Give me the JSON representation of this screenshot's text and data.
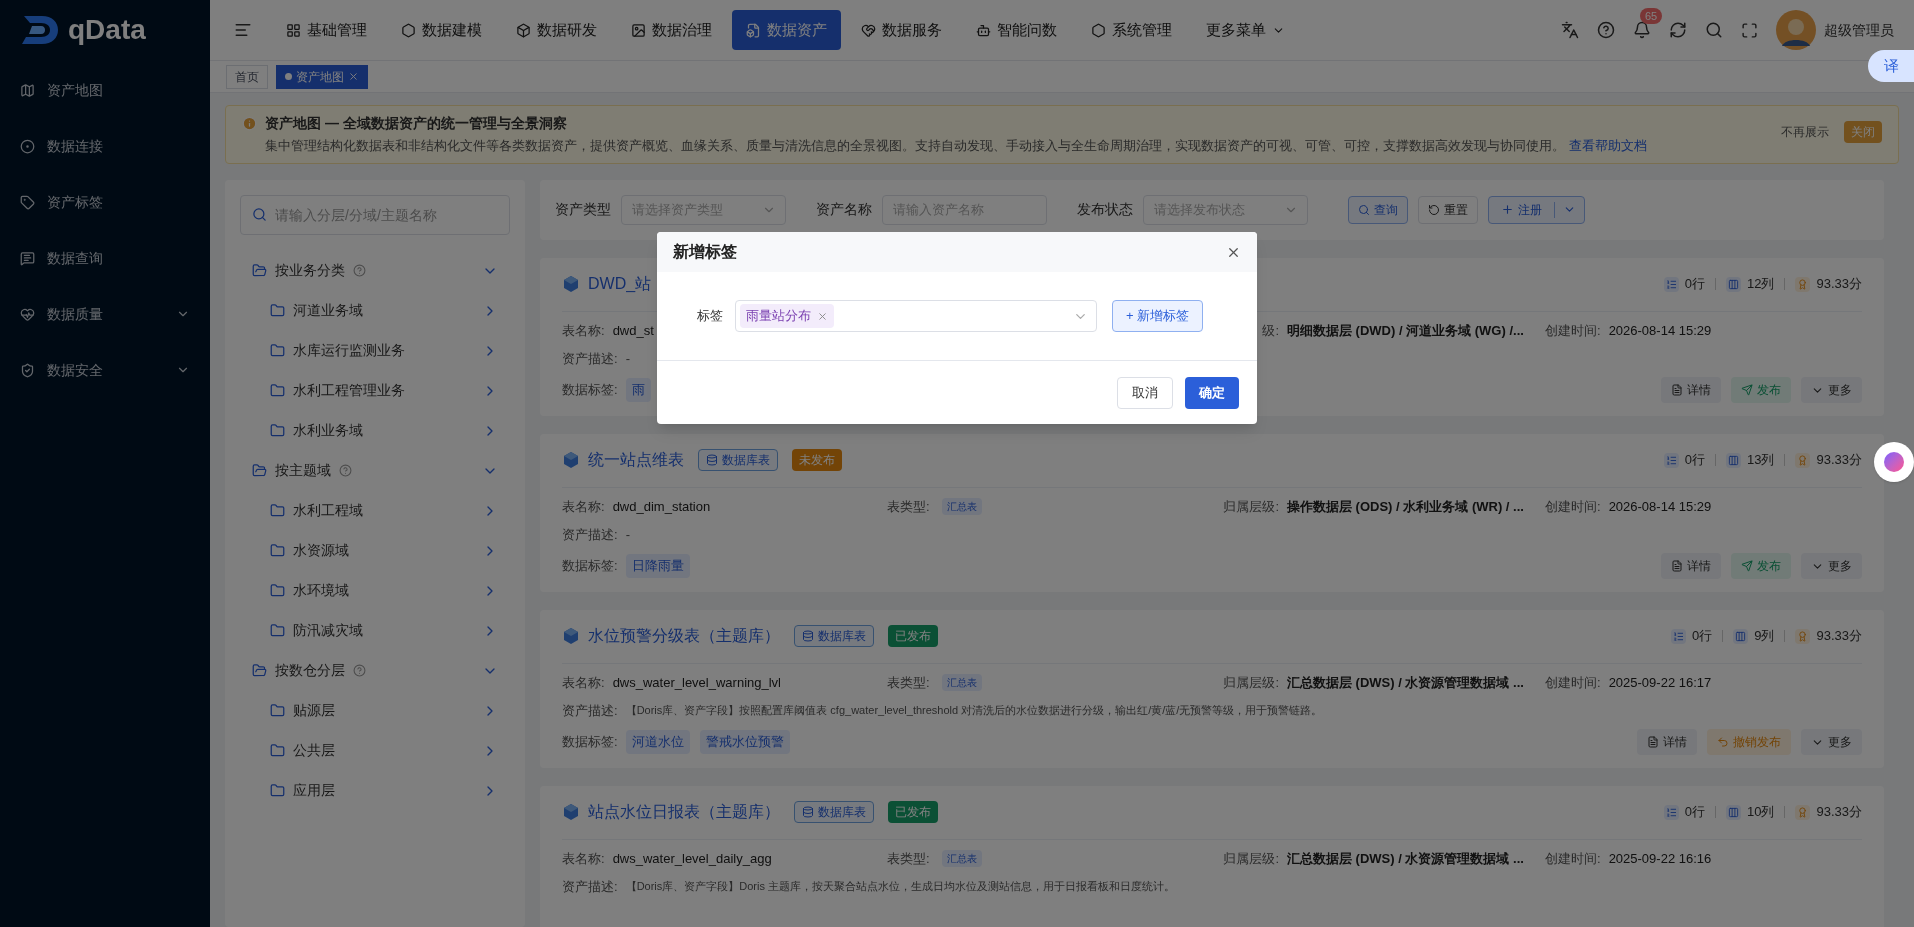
{
  "sidebar": {
    "logo": "qData",
    "items": [
      {
        "label": "资产地图",
        "has_submenu": false
      },
      {
        "label": "数据连接",
        "has_submenu": false
      },
      {
        "label": "资产标签",
        "has_submenu": false
      },
      {
        "label": "数据查询",
        "has_submenu": false
      },
      {
        "label": "数据质量",
        "has_submenu": true
      },
      {
        "label": "数据安全",
        "has_submenu": true
      }
    ]
  },
  "top_nav": {
    "items": [
      {
        "label": "基础管理",
        "selected": false,
        "has_menu": false
      },
      {
        "label": "数据建模",
        "selected": false,
        "has_menu": false
      },
      {
        "label": "数据研发",
        "selected": false,
        "has_menu": false
      },
      {
        "label": "数据治理",
        "selected": false,
        "has_menu": false
      },
      {
        "label": "数据资产",
        "selected": true,
        "has_menu": false
      },
      {
        "label": "数据服务",
        "selected": false,
        "has_menu": false
      },
      {
        "label": "智能问数",
        "selected": false,
        "has_menu": false
      },
      {
        "label": "系统管理",
        "selected": false,
        "has_menu": false
      },
      {
        "label": "更多菜单",
        "selected": false,
        "has_menu": true
      }
    ],
    "notification_count": "65",
    "user": "超级管理员"
  },
  "tabs": [
    {
      "label": "首页",
      "selected": false,
      "closable": false
    },
    {
      "label": "资产地图",
      "selected": true,
      "closable": true
    }
  ],
  "banner": {
    "title": "资产地图 — 全域数据资产的统一管理与全景洞察",
    "text": "集中管理结构化数据表和非结构化文件等各类数据资产，提供资产概览、血缘关系、质量与清洗信息的全景视图。支持自动发现、手动接入与全生命周期治理，实现数据资产的可视、可管、可控，支撑数据高效发现与协同使用。",
    "link": "查看帮助文档",
    "buttons": [
      {
        "label": "不再展示",
        "kind": "text"
      },
      {
        "label": "关闭",
        "kind": "warning"
      }
    ]
  },
  "tree": {
    "search_placeholder": "请输入分层/分域/主题名称",
    "groups": [
      {
        "label": "按业务分类",
        "expanded": true,
        "children": [
          {
            "label": "河道业务域"
          },
          {
            "label": "水库运行监测业务"
          },
          {
            "label": "水利工程管理业务"
          },
          {
            "label": "水利业务域"
          }
        ]
      },
      {
        "label": "按主题域",
        "expanded": true,
        "children": [
          {
            "label": "水利工程域"
          },
          {
            "label": "水资源域"
          },
          {
            "label": "水环境域"
          },
          {
            "label": "防汛减灾域"
          }
        ]
      },
      {
        "label": "按数仓分层",
        "expanded": true,
        "children": [
          {
            "label": "贴源层"
          },
          {
            "label": "公共层"
          },
          {
            "label": "应用层"
          }
        ]
      }
    ]
  },
  "filters": [
    {
      "label": "资产类型",
      "placeholder": "请选择资产类型",
      "kind": "select"
    },
    {
      "label": "资产名称",
      "placeholder": "请输入资产名称",
      "kind": "input"
    },
    {
      "label": "发布状态",
      "placeholder": "请选择发布状态",
      "kind": "select"
    }
  ],
  "filter_buttons": [
    {
      "label": "查询",
      "kind": "search"
    },
    {
      "label": "重置",
      "kind": "reset"
    },
    {
      "label": "注册",
      "kind": "register"
    }
  ],
  "cards": [
    {
      "title": "DWD_站",
      "stats": [
        {
          "kind": "rows",
          "text": "0行"
        },
        {
          "kind": "columns",
          "text": "12列"
        },
        {
          "kind": "score",
          "text": "93.33分"
        }
      ],
      "table_name": {
        "label": "表名称:",
        "value": "dwd_st"
      },
      "layer": {
        "label": "级:",
        "value": "明细数据层 (DWD) / 河道业务域 (WG) /..."
      },
      "created": {
        "label": "创建时间:",
        "value": "2026-08-14 15:29"
      },
      "desc": {
        "label": "资产描述:",
        "value": "-"
      },
      "tags": {
        "label": "数据标签:",
        "items": [
          "雨"
        ]
      },
      "actions": [
        {
          "label": "详情",
          "kind": "detail"
        },
        {
          "label": "发布",
          "kind": "publish"
        },
        {
          "label": "更多",
          "kind": "more"
        }
      ]
    },
    {
      "title": "统一站点维表",
      "badges": [
        {
          "text": "数据库表",
          "kind": "db"
        },
        {
          "text": "未发布",
          "kind": "unpublished"
        }
      ],
      "stats": [
        {
          "kind": "rows",
          "text": "0行"
        },
        {
          "kind": "columns",
          "text": "13列"
        },
        {
          "kind": "score",
          "text": "93.33分"
        }
      ],
      "table_name": {
        "label": "表名称:",
        "value": "dwd_dim_station"
      },
      "table_type": {
        "label": "表类型:",
        "value": "汇总表"
      },
      "layer": {
        "label": "归属层级:",
        "value": "操作数据层 (ODS) / 水利业务域 (WR) / ..."
      },
      "created": {
        "label": "创建时间:",
        "value": "2026-08-14 15:29"
      },
      "desc": {
        "label": "资产描述:",
        "value": "-"
      },
      "tags": {
        "label": "数据标签:",
        "items": [
          "日降雨量"
        ]
      },
      "actions": [
        {
          "label": "详情",
          "kind": "detail"
        },
        {
          "label": "发布",
          "kind": "publish"
        },
        {
          "label": "更多",
          "kind": "more"
        }
      ]
    },
    {
      "title": "水位预警分级表（主题库）",
      "badges": [
        {
          "text": "数据库表",
          "kind": "db"
        },
        {
          "text": "已发布",
          "kind": "published"
        }
      ],
      "stats": [
        {
          "kind": "rows",
          "text": "0行"
        },
        {
          "kind": "columns",
          "text": "9列"
        },
        {
          "kind": "score",
          "text": "93.33分"
        }
      ],
      "table_name": {
        "label": "表名称:",
        "value": "dws_water_level_warning_lvl"
      },
      "table_type": {
        "label": "表类型:",
        "value": "汇总表"
      },
      "layer": {
        "label": "归属层级:",
        "value": "汇总数据层 (DWS) / 水资源管理数据域 ..."
      },
      "created": {
        "label": "创建时间:",
        "value": "2025-09-22 16:17"
      },
      "desc": {
        "label": "资产描述:",
        "value": "【Doris库、资产字段】按照配置库阈值表 cfg_water_level_threshold 对清洗后的水位数据进行分级，输出红/黄/蓝/无预警等级，用于预警链路。"
      },
      "tags": {
        "label": "数据标签:",
        "items": [
          "河道水位",
          "警戒水位预警"
        ]
      },
      "actions": [
        {
          "label": "详情",
          "kind": "detail"
        },
        {
          "label": "撤销发布",
          "kind": "revoke"
        },
        {
          "label": "更多",
          "kind": "more"
        }
      ]
    },
    {
      "title": "站点水位日报表（主题库）",
      "badges": [
        {
          "text": "数据库表",
          "kind": "db"
        },
        {
          "text": "已发布",
          "kind": "published"
        }
      ],
      "stats": [
        {
          "kind": "rows",
          "text": "0行"
        },
        {
          "kind": "columns",
          "text": "10列"
        },
        {
          "kind": "score",
          "text": "93.33分"
        }
      ],
      "table_name": {
        "label": "表名称:",
        "value": "dws_water_level_daily_agg"
      },
      "table_type": {
        "label": "表类型:",
        "value": "汇总表"
      },
      "layer": {
        "label": "归属层级:",
        "value": "汇总数据层 (DWS) / 水资源管理数据域 ..."
      },
      "created": {
        "label": "创建时间:",
        "value": "2025-09-22 16:16"
      },
      "desc": {
        "label": "资产描述:",
        "value": "【Doris库、资产字段】Doris 主题库，按天聚合站点水位，生成日均水位及测站信息，用于日报看板和日度统计。"
      }
    }
  ],
  "dialog": {
    "title": "新增标签",
    "field_label": "标签",
    "tags": [
      "雨量站分布"
    ],
    "add_button": "+ 新增标签",
    "buttons": [
      {
        "label": "取消",
        "kind": "default"
      },
      {
        "label": "确定",
        "kind": "primary"
      }
    ]
  },
  "translate_button": "译"
}
